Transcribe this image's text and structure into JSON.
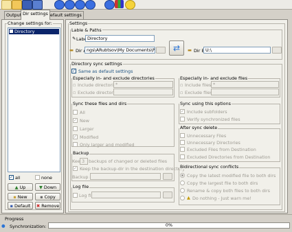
{
  "toolbar": {
    "icons": [
      "new-icon",
      "open-icon",
      "save-icon",
      "save-as-icon",
      "run-icon",
      "sync-icon",
      "sync-all-icon",
      "help-icon",
      "about-icon",
      "books-icon",
      "smiley-icon"
    ]
  },
  "tabs": [
    "Output",
    "Dir settings",
    "Default settings"
  ],
  "active_tab": "Dir settings",
  "left": {
    "title": "Change settings for:",
    "items": [
      "Directory"
    ],
    "all_label": "all",
    "none_label": "none",
    "up_label": "Up",
    "down_label": "Down",
    "new_label": "New",
    "copy_label": "Copy",
    "default_label": "Default",
    "remove_label": "Remove"
  },
  "settings": {
    "title": "Settings",
    "lable_paths": {
      "title": "Lable & Paths",
      "label_caption": "Label",
      "label_value": "Directory",
      "dir_a_caption": "Dir A",
      "dir_a_value": "ngs\\ARubtsov\\My Documents\\Projects",
      "dir_b_caption": "Dir B",
      "dir_b_value": "U:\\"
    },
    "sync": {
      "title": "Directory sync settings",
      "same_as_default": "Same as default settings",
      "inex_dirs": {
        "title": "Especially in- and exclude directories",
        "include": "Include directories:",
        "exclude": "Exclude directories:",
        "include_value": "*"
      },
      "inex_files": {
        "title": "Especially in- and exclude files",
        "include": "Include files:",
        "exclude": "Exclude files:",
        "include_value": "*"
      },
      "sync_these": {
        "title": "Sync these files and dirs",
        "items": [
          {
            "label": "All",
            "checked": false
          },
          {
            "label": "New",
            "checked": true
          },
          {
            "label": "Larger",
            "checked": false
          },
          {
            "label": "Modified",
            "checked": true
          },
          {
            "label": "Only larger and modified",
            "checked": false
          }
        ]
      },
      "sync_using": {
        "title": "Sync using this options",
        "items": [
          {
            "label": "Include subfolders",
            "checked": true
          },
          {
            "label": "Verify synchronized files",
            "checked": false
          }
        ]
      },
      "after_delete": {
        "title": "After sync delete",
        "items": [
          {
            "label": "Unnecessary Files",
            "checked": false
          },
          {
            "label": "Unnecessary Directories",
            "checked": false
          },
          {
            "label": "Excluded Files from Destination",
            "checked": false
          },
          {
            "label": "Excluded Directories from Destination",
            "checked": false
          }
        ]
      },
      "backup": {
        "title": "Backup",
        "keep_pre": "Keep",
        "keep_value": "3",
        "keep_post": "backups of changed or deleted files",
        "keep_in_dest": "Keep the backup-dir in the destination directory",
        "backup_dir": "Backup dir:"
      },
      "log": {
        "title": "Log file",
        "log_file": "Log file:"
      },
      "bidir": {
        "title": "Bidirectional sync conflicts",
        "items": [
          {
            "label": "Copy the latest modified file to both dirs",
            "checked": true
          },
          {
            "label": "Copy the largest file to both dirs",
            "checked": false
          },
          {
            "label": "Rename & copy both files to both dirs",
            "checked": false
          },
          {
            "label": "Do nothing - Just warn me!",
            "checked": false
          }
        ]
      }
    }
  },
  "progress": {
    "title": "Progress",
    "sync_label": "Synchronization:",
    "percent": "0%",
    "value": 0
  },
  "colors": {
    "accent": "#0a246a",
    "panel": "#f1f0ea",
    "frame": "#d4d0c8"
  }
}
